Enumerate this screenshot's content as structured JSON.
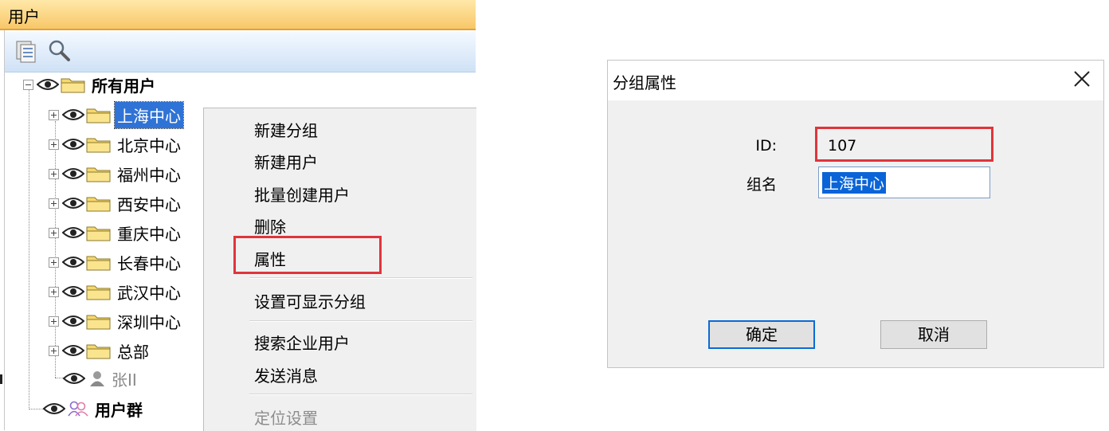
{
  "panel": {
    "title": "用户",
    "toolbar": {
      "icons": [
        "user-list-icon",
        "search-icon"
      ]
    },
    "tree": {
      "root": {
        "label": "所有用户",
        "icon": "folder-icon"
      },
      "groups": [
        {
          "label": "上海中心",
          "selected": true
        },
        {
          "label": "北京中心"
        },
        {
          "label": "福州中心"
        },
        {
          "label": "西安中心"
        },
        {
          "label": "重庆中心"
        },
        {
          "label": "长春中心"
        },
        {
          "label": "武汉中心"
        },
        {
          "label": "深圳中心"
        },
        {
          "label": "总部"
        }
      ],
      "user": {
        "label": "张II",
        "icon": "user-icon"
      },
      "user_groups": {
        "label": "用户群",
        "icon": "user-group-icon"
      }
    }
  },
  "context_menu": {
    "items": [
      {
        "label": "新建分组"
      },
      {
        "label": "新建用户"
      },
      {
        "label": "批量创建用户"
      },
      {
        "label": "删除"
      },
      {
        "label": "属性",
        "highlighted": true
      },
      {
        "label": "设置可显示分组"
      },
      {
        "label": "搜索企业用户"
      },
      {
        "label": "发送消息"
      },
      {
        "label": "定位设置",
        "disabled": true
      }
    ]
  },
  "dialog": {
    "title": "分组属性",
    "id_label": "ID:",
    "id_value": "107",
    "name_label": "组名",
    "name_value": "上海中心",
    "ok_label": "确定",
    "cancel_label": "取消"
  },
  "colors": {
    "highlight_box": "#e0343b",
    "selection": "#2f73d6",
    "title_bar": "#f8c768",
    "toolbar": "#cfe1f6"
  }
}
